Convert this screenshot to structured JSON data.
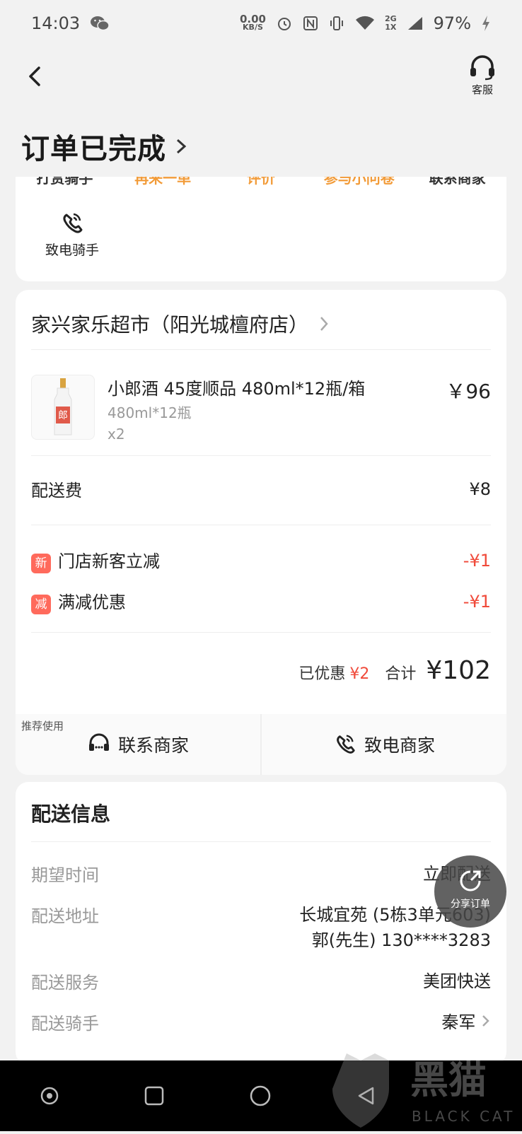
{
  "status_bar": {
    "time": "14:03",
    "speed_value": "0.00",
    "speed_unit": "KB/S",
    "net_label_top": "2G",
    "net_label_bottom": "1X",
    "battery": "97%"
  },
  "header": {
    "customer_service_label": "客服",
    "title": "订单已完成"
  },
  "actions": {
    "cut_labels": [
      "打赏骑手",
      "再来一单",
      "评价",
      "参与小问卷",
      "联系商家"
    ],
    "call_rider_label": "致电骑手"
  },
  "shop": {
    "name": "家兴家乐超市（阳光城檀府店）"
  },
  "product": {
    "name": "小郎酒 45度顺品 480ml*12瓶/箱",
    "spec": "480ml*12瓶",
    "qty": "x2",
    "price": "￥96",
    "thumb_glyph": "郎"
  },
  "fees": {
    "delivery_label": "配送费",
    "delivery_value": "¥8",
    "discounts": [
      {
        "tag": "新",
        "label": "门店新客立减",
        "value": "-¥1"
      },
      {
        "tag": "减",
        "label": "满减优惠",
        "value": "-¥1"
      }
    ]
  },
  "summary": {
    "saved_label": "已优惠",
    "saved_value": "¥2",
    "total_label": "合计",
    "total_value": "¥102"
  },
  "buttons": {
    "recommend_label": "推荐使用",
    "contact_merchant": "联系商家",
    "call_merchant": "致电商家"
  },
  "delivery": {
    "section_title": "配送信息",
    "rows": [
      {
        "key": "期望时间",
        "value": "立即配送"
      },
      {
        "key": "配送地址",
        "value": "长城宜苑 (5栋3单元603)",
        "value2": "郭(先生) 130****3283"
      },
      {
        "key": "配送服务",
        "value": "美团快送"
      },
      {
        "key": "配送骑手",
        "value": "秦军"
      }
    ]
  },
  "share": {
    "label": "分享订单"
  },
  "watermark": {
    "text": "黑猫",
    "sub": "BLACK CAT"
  }
}
